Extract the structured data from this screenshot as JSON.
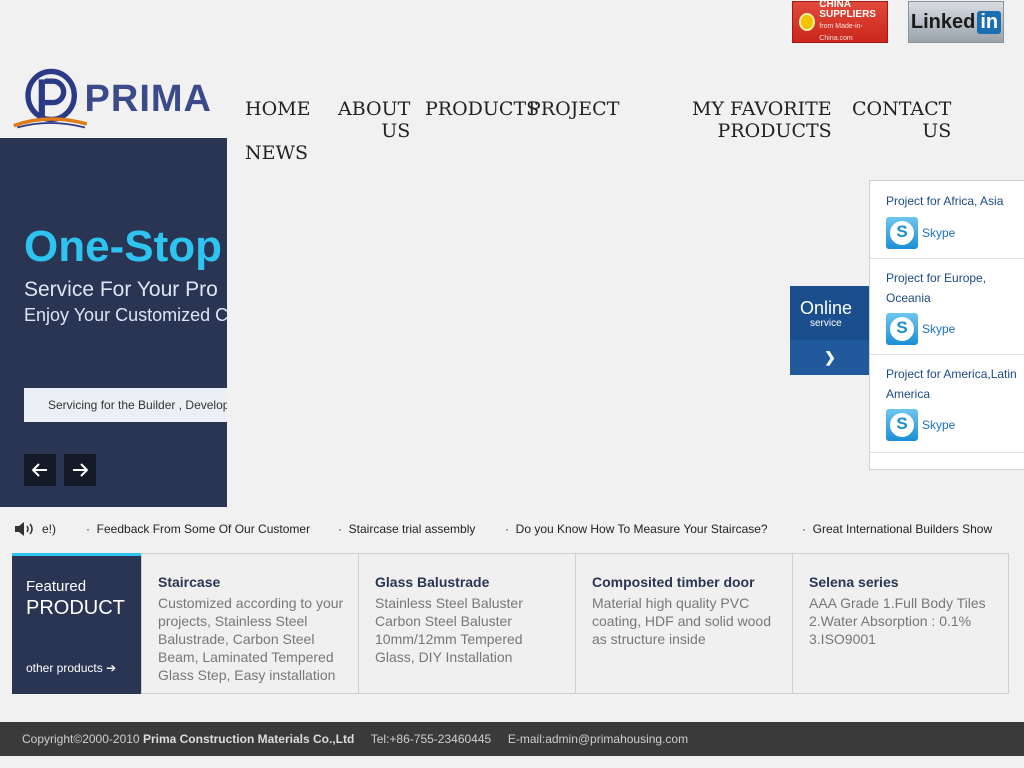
{
  "badges": {
    "china_line1": "CHINA",
    "china_line2": "SUPPLIERS",
    "china_line3": "from Made-in-China.com",
    "linkedin_text": "Linked",
    "linkedin_in": "in"
  },
  "logo": {
    "text": "PRIMA"
  },
  "nav": {
    "home": "HOME",
    "about_1": "ABOUT",
    "about_2": "US",
    "products": "PRODUCTS",
    "project": "PROJECT",
    "favorite_1": "MY FAVORITE",
    "favorite_2": "PRODUCTS",
    "contact_1": "CONTACT",
    "contact_2": "US",
    "news": "NEWS"
  },
  "hero": {
    "title": "One-Stop",
    "subtitle1": "Service For Your Pro",
    "subtitle2": "Enjoy Your Customized C",
    "bar_text": "Servicing for the Builder , Develop"
  },
  "online_service": {
    "line1": "Online",
    "line2": "service"
  },
  "contact_panel": [
    {
      "title": "Project for Africa, Asia",
      "skype": "Skype"
    },
    {
      "title": "Project for Europe, Oceania",
      "skype": "Skype"
    },
    {
      "title": "Project for America,Latin America",
      "skype": "Skype"
    }
  ],
  "ticker": {
    "partial": "e!)",
    "items": [
      "Feedback From Some Of Our Customer",
      "Staircase trial assembly",
      "Do you Know How To Measure Your Staircase?",
      "Great International Builders Show"
    ]
  },
  "featured": {
    "label1": "Featured",
    "label2": "PRODUCT",
    "more": "other products",
    "products": [
      {
        "title": "Staircase",
        "desc": "Customized according to your projects, Stainless Steel Balustrade, Carbon Steel Beam, Laminated Tempered Glass Step, Easy installation"
      },
      {
        "title": "Glass Balustrade",
        "desc": "Stainless Steel Baluster Carbon Steel Baluster 10mm/12mm Tempered Glass, DIY Installation"
      },
      {
        "title": "Composited timber door",
        "desc": "Material high quality PVC coating, HDF and solid wood as structure inside"
      },
      {
        "title": "Selena series",
        "desc": "AAA Grade 1.Full Body Tiles 2.Water Absorption : 0.1% 3.ISO9001"
      }
    ]
  },
  "footer": {
    "copyright": "Copyright©2000-2010",
    "company": "Prima Construction Materials Co.,Ltd",
    "tel": "Tel:+86-755-23460445",
    "email": "E-mail:admin@primahousing.com"
  },
  "colors": {
    "navy": "#2a3553",
    "accent_cyan": "#2ec4f1",
    "link_blue": "#1d4a86"
  }
}
